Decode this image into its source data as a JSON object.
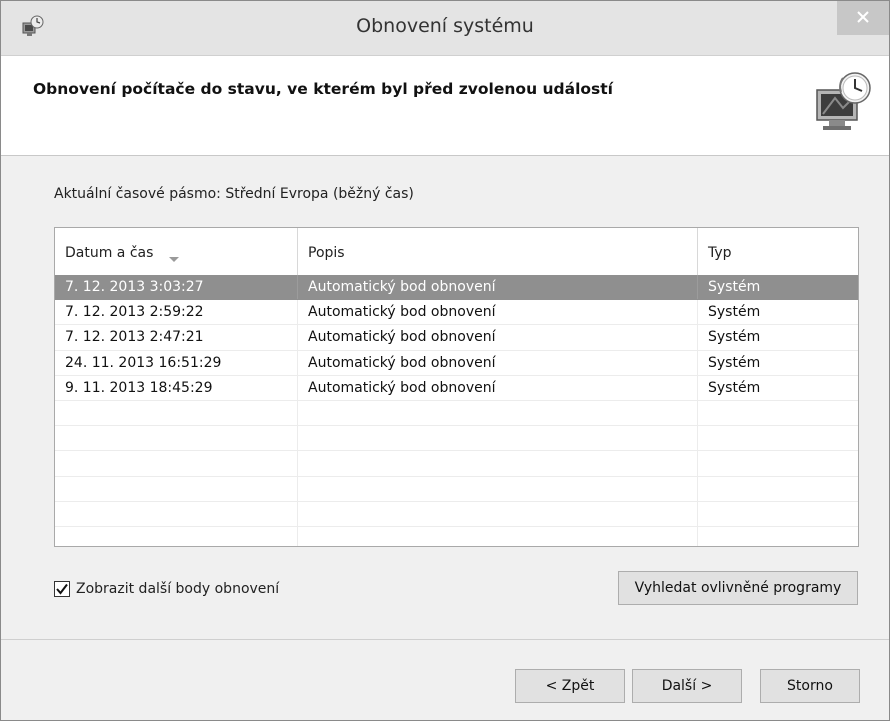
{
  "window": {
    "title": "Obnovení systému"
  },
  "header": {
    "title": "Obnovení počítače do stavu, ve kterém byl před zvolenou událostí"
  },
  "timezone_label": "Aktuální časové pásmo: Střední Evropa (běžný čas)",
  "table": {
    "columns": [
      "Datum a čas",
      "Popis",
      "Typ"
    ],
    "rows": [
      {
        "date": "7. 12. 2013 3:03:27",
        "description": "Automatický bod obnovení",
        "type": "Systém",
        "selected": true
      },
      {
        "date": "7. 12. 2013 2:59:22",
        "description": "Automatický bod obnovení",
        "type": "Systém",
        "selected": false
      },
      {
        "date": "7. 12. 2013 2:47:21",
        "description": "Automatický bod obnovení",
        "type": "Systém",
        "selected": false
      },
      {
        "date": "24. 11. 2013 16:51:29",
        "description": "Automatický bod obnovení",
        "type": "Systém",
        "selected": false
      },
      {
        "date": "9. 11. 2013 18:45:29",
        "description": "Automatický bod obnovení",
        "type": "Systém",
        "selected": false
      }
    ],
    "empty_rows": 6
  },
  "show_more": {
    "label": "Zobrazit další body obnovení",
    "checked": true
  },
  "buttons": {
    "find_affected": "Vyhledat ovlivněné programy",
    "back": "< Zpět",
    "next": "Další >",
    "cancel": "Storno"
  },
  "icons": {
    "app": "system-restore-icon",
    "close": "close-icon",
    "header": "computer-clock-icon",
    "sort": "sort-descending-icon",
    "checkbox": "checkmark-icon"
  },
  "colors": {
    "selected_row": "#8f8f8f",
    "close_button": "#c7c7c7"
  }
}
